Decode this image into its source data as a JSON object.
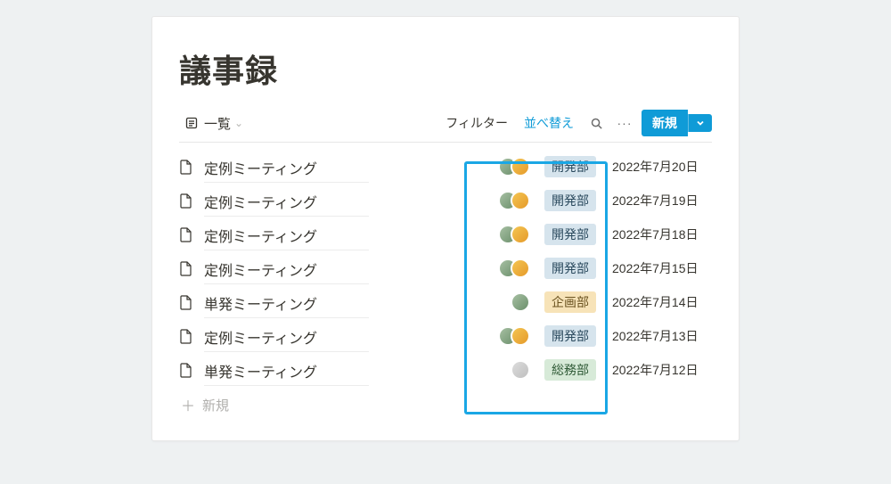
{
  "title": "議事録",
  "toolbar": {
    "view_label": "一覧",
    "filter_label": "フィルター",
    "sort_label": "並べ替え",
    "new_label": "新規"
  },
  "tags": {
    "dev": "開発部",
    "plan": "企画部",
    "ga": "総務部"
  },
  "rows": [
    {
      "title": "定例ミーティング",
      "avatars": [
        "a",
        "b"
      ],
      "tag": "dev",
      "date": "2022年7月20日"
    },
    {
      "title": "定例ミーティング",
      "avatars": [
        "a",
        "b"
      ],
      "tag": "dev",
      "date": "2022年7月19日"
    },
    {
      "title": "定例ミーティング",
      "avatars": [
        "a",
        "b"
      ],
      "tag": "dev",
      "date": "2022年7月18日"
    },
    {
      "title": "定例ミーティング",
      "avatars": [
        "a",
        "b"
      ],
      "tag": "dev",
      "date": "2022年7月15日"
    },
    {
      "title": "単発ミーティング",
      "avatars": [
        "c"
      ],
      "tag": "plan",
      "date": "2022年7月14日"
    },
    {
      "title": "定例ミーティング",
      "avatars": [
        "a",
        "b"
      ],
      "tag": "dev",
      "date": "2022年7月13日"
    },
    {
      "title": "単発ミーティング",
      "avatars": [
        "d"
      ],
      "tag": "ga",
      "date": "2022年7月12日"
    }
  ],
  "add_row_label": "新規"
}
